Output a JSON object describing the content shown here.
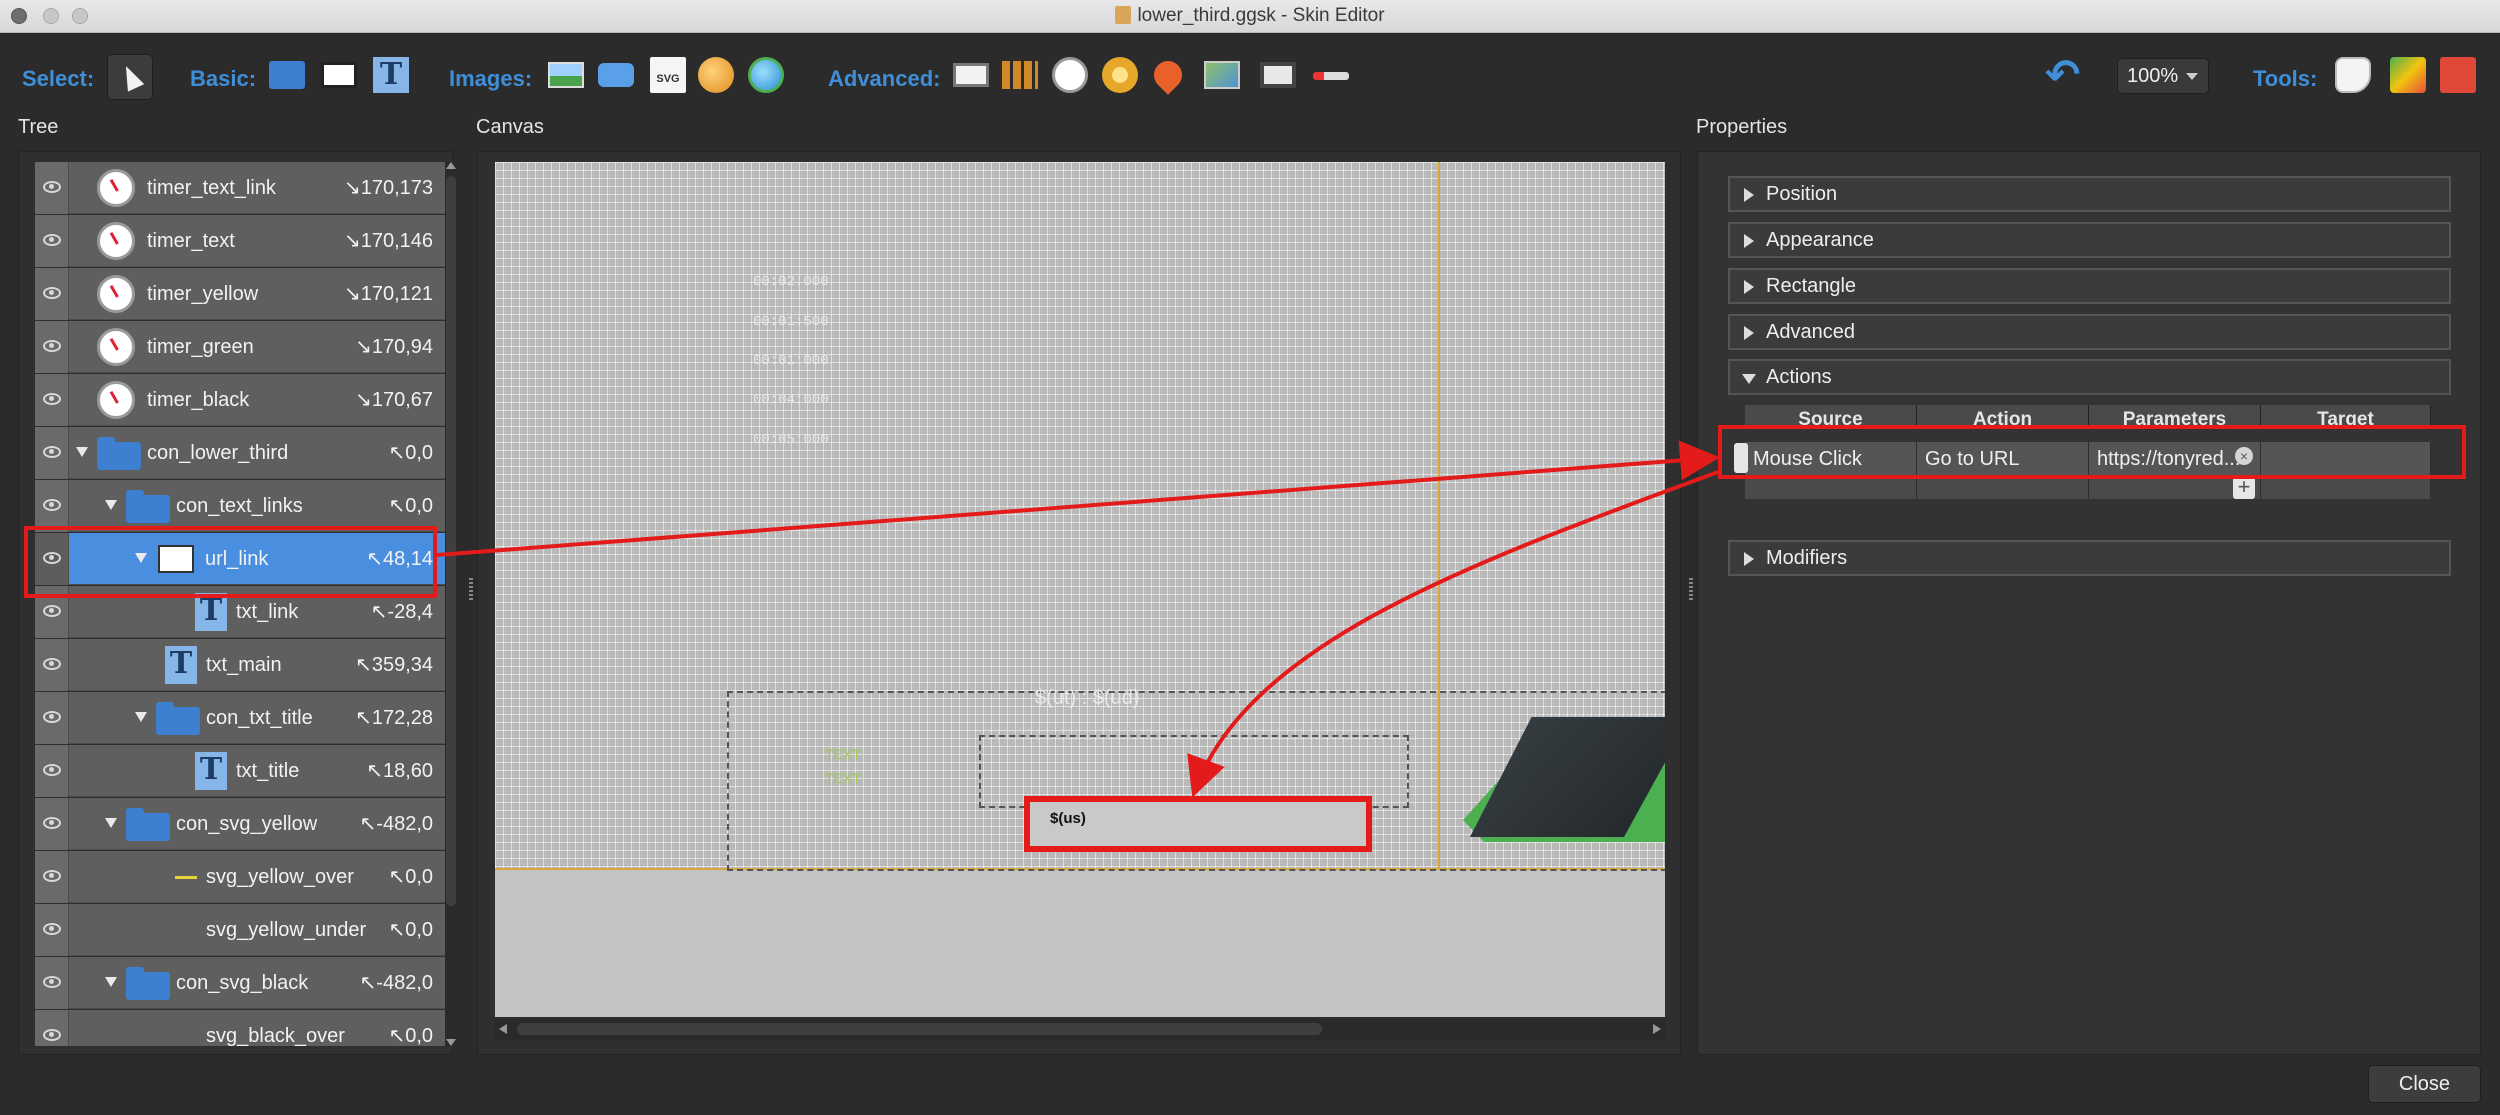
{
  "window": {
    "title": "lower_third.ggsk - Skin Editor"
  },
  "toolbar": {
    "select_label": "Select:",
    "basic_label": "Basic:",
    "images_label": "Images:",
    "advanced_label": "Advanced:",
    "tools_label": "Tools:",
    "zoom": "100%",
    "svg_badge": "SVG"
  },
  "panels": {
    "tree": "Tree",
    "canvas": "Canvas",
    "properties": "Properties"
  },
  "tree": {
    "rows": [
      {
        "label": "timer_text_link",
        "pos": "↘170,173"
      },
      {
        "label": "timer_text",
        "pos": "↘170,146"
      },
      {
        "label": "timer_yellow",
        "pos": "↘170,121"
      },
      {
        "label": "timer_green",
        "pos": "↘170,94"
      },
      {
        "label": "timer_black",
        "pos": "↘170,67"
      },
      {
        "label": "con_lower_third",
        "pos": "↖0,0"
      },
      {
        "label": "con_text_links",
        "pos": "↖0,0"
      },
      {
        "label": "url_link",
        "pos": "↖48,14"
      },
      {
        "label": "txt_link",
        "pos": "↖-28,4"
      },
      {
        "label": "txt_main",
        "pos": "↖359,34"
      },
      {
        "label": "con_txt_title",
        "pos": "↖172,28"
      },
      {
        "label": "txt_title",
        "pos": "↖18,60"
      },
      {
        "label": "con_svg_yellow",
        "pos": "↖-482,0"
      },
      {
        "label": "svg_yellow_over",
        "pos": "↖0,0"
      },
      {
        "label": "svg_yellow_under",
        "pos": "↖0,0"
      },
      {
        "label": "con_svg_black",
        "pos": "↖-482,0"
      },
      {
        "label": "svg_black_over",
        "pos": "↖0,0"
      }
    ]
  },
  "canvas": {
    "timers": [
      "00:02:000",
      "00:01:500",
      "00:01:000",
      "00:04:000",
      "00:05:000"
    ],
    "ut_text": "$(ut) : $(ud)",
    "us_text": "$(us)",
    "green_text_1": "TEXT",
    "green_text_2": "TEXT"
  },
  "properties": {
    "sections": {
      "position": "Position",
      "appearance": "Appearance",
      "rectangle": "Rectangle",
      "advanced": "Advanced",
      "actions": "Actions",
      "modifiers": "Modifiers"
    },
    "actions_table": {
      "headers": {
        "source": "Source",
        "action": "Action",
        "parameters": "Parameters",
        "target": "Target"
      },
      "row": {
        "source": "Mouse Click",
        "action": "Go to URL",
        "parameters": "https://tonyred...",
        "target": ""
      }
    }
  },
  "footer": {
    "close": "Close"
  },
  "colors": {
    "accent": "#3f8fd8",
    "selected": "#4a8ee0",
    "annotation": "#e31b1b"
  }
}
